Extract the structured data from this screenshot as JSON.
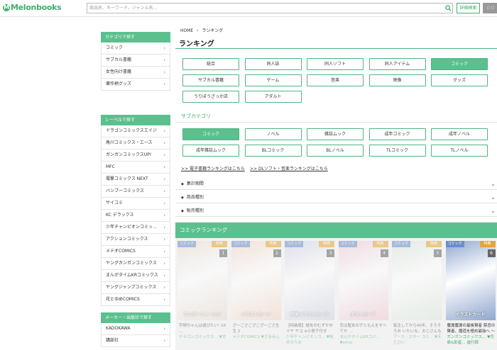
{
  "header": {
    "logo": "Melonbooks",
    "search_placeholder": "商品名、キーワード、ジャンル名…",
    "advanced_search": "詳細検索",
    "extra_button": "▢ ▢"
  },
  "sidebar": {
    "categories": {
      "heading": "カテゴリで探す",
      "items": [
        "コミック",
        "サブカル書籍",
        "女性向け書籍",
        "薬作柄グッズ"
      ]
    },
    "labels": {
      "heading": "レーベルで探す",
      "items": [
        "ドラゴンコミックスエイジ",
        "角川コミックス・エース",
        "ガンガンコミックスUP!",
        "MFC",
        "電撃コミックス NEXT",
        "バンブーコミックス",
        "サイコミ",
        "KC デラックス",
        "少年チャンピオンコミッ…",
        "アクションコミックス",
        "メテオCOMICS",
        "ヤングガンガンコミックス",
        "まんがタイムKRコミックス",
        "ヤングジャンプコミックス",
        "花とゆめCOMICS"
      ]
    },
    "makers": {
      "heading": "メーカー・出版社で探す",
      "items": [
        "KADOKAWA",
        "講談社"
      ]
    }
  },
  "main": {
    "breadcrumb": {
      "home": "HOME",
      "sep": "›",
      "current": "ランキング"
    },
    "title": "ランキング",
    "categories": [
      "総合",
      "同人誌",
      "同人ソフト",
      "同人アイテム",
      "コミック",
      "サブカル書籍",
      "ゲーム",
      "音楽",
      "映像",
      "グッズ",
      "うりぼうざっか店",
      "アダルト"
    ],
    "active_category": "コミック",
    "subcategory_heading": "サブカテゴリ",
    "subcategories": [
      "コミック",
      "ノベル",
      "雑誌ムック",
      "成年コミック",
      "成年ノベル",
      "成年雑誌ムック",
      "BLコミック",
      "BLノベル",
      "TLコミック",
      "TLノベル"
    ],
    "active_subcategory": "コミック",
    "links": [
      ">> 電子書籍ランキングはこちら",
      ">> DLソフト・音楽ランキングはこちら"
    ],
    "filters": [
      "集計期間",
      "商品種別",
      "販売種別"
    ],
    "ranking_heading": "コミックランキング"
  },
  "ranking": [
    {
      "rank": "1",
      "tag": "コミック",
      "flag": "特典",
      "caption": "ワンダーフィールド",
      "title": "宇崎ちゃんは遊びたい! 10 …",
      "sub": "ドラゴンコミックス…  ▼丈",
      "cover": "#e9dcd0"
    },
    {
      "rank": "2",
      "tag": "コミック",
      "flag": "特典",
      "caption": "イラストカード",
      "title": "ざ〜ごさござござ〜ごさ生生 2",
      "sub": "メテオCOMICS  ▼ざるみん",
      "cover": "#f3d6c4"
    },
    {
      "rank": "3",
      "tag": "コミック",
      "flag": "特典",
      "caption": "両面イラストカード",
      "title": "【特装版】彼女のむずかゆイヤ ヤコ ※小冊子付き",
      "sub": "少年チャンピオンコ…  ▼桜井のりお",
      "cover": "#cfd2e6"
    },
    {
      "rank": "4",
      "tag": "コミック",
      "flag": "特典",
      "caption": "ポストカード",
      "title": "恋は聖女の子ともえをすべてか …",
      "sub": "まんがタイムKRコミ…  ▼eifuk",
      "cover": "#efc8d3"
    },
    {
      "rank": "5",
      "tag": "コミック",
      "flag": "特典",
      "caption": "",
      "title": "転生してから40年、そろそろお いたいな。おじさんも恋がした…",
      "sub": "アース・スター コミ…  ▼天乙ひい",
      "cover": "#d9e6da"
    },
    {
      "rank": "6",
      "tag": "コミック",
      "flag": "特典",
      "caption": "イラストカード",
      "title": "魔導魔導の最後賢者 禁忌の賢者、魔道を極め最強へ ～",
      "sub": "ガンガンコミックス… ▼月島&影星… 進行諦",
      "cover": "#8fa7cf"
    }
  ],
  "colors": {
    "accent": "#5bc08e",
    "accent_dark": "#3fae6b"
  }
}
